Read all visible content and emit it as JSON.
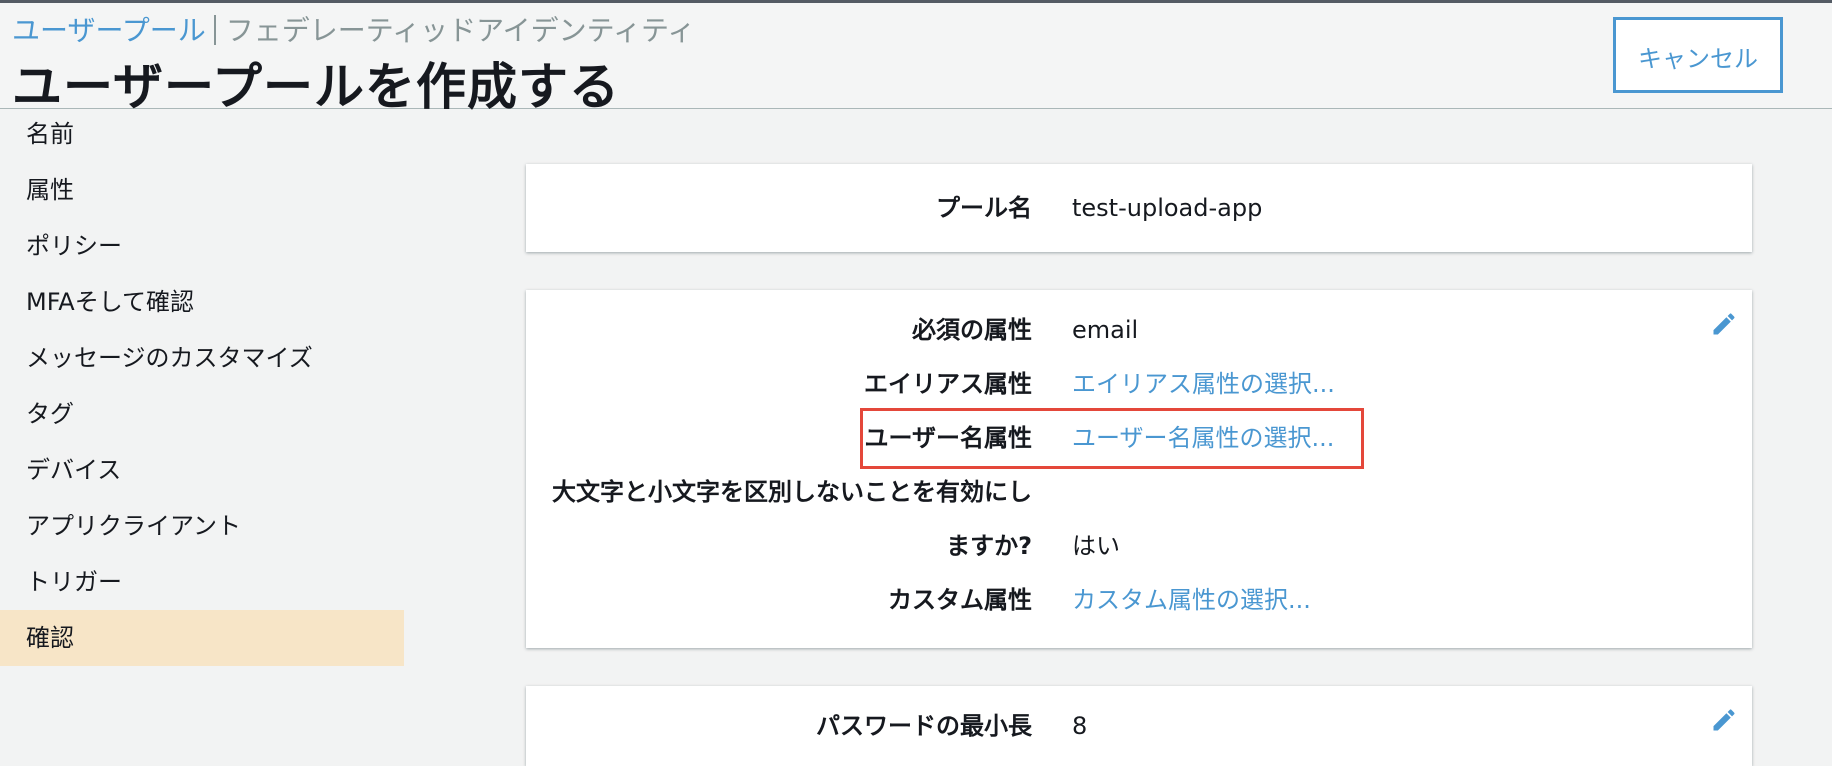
{
  "breadcrumb": {
    "link": "ユーザープール",
    "current": "フェデレーティッドアイデンティティ"
  },
  "page_title": "ユーザープールを作成する",
  "cancel_label": "キャンセル",
  "sidebar": {
    "items": [
      {
        "label": "名前"
      },
      {
        "label": "属性"
      },
      {
        "label": "ポリシー"
      },
      {
        "label": "MFAそして確認"
      },
      {
        "label": "メッセージのカスタマイズ"
      },
      {
        "label": "タグ"
      },
      {
        "label": "デバイス"
      },
      {
        "label": "アプリクライアント"
      },
      {
        "label": "トリガー"
      },
      {
        "label": "確認"
      }
    ],
    "active_index": 9
  },
  "pool_card": {
    "label": "プール名",
    "value": "test-upload-app"
  },
  "attributes_card": {
    "required_label": "必須の属性",
    "required_value": "email",
    "alias_label": "エイリアス属性",
    "alias_link": "エイリアス属性の選択...",
    "username_label": "ユーザー名属性",
    "username_link": "ユーザー名属性の選択...",
    "case_label_line1": "大文字と小文字を区別しないことを有効にし",
    "case_label_line2": "ますか?",
    "case_value": "はい",
    "custom_label": "カスタム属性",
    "custom_link": "カスタム属性の選択..."
  },
  "password_card": {
    "min_length_label": "パスワードの最小長",
    "min_length_value": "8"
  },
  "colors": {
    "link": "#4a97d1",
    "active_nav": "#f7e5c7",
    "highlight": "#e4473a"
  },
  "icons": {
    "edit": "pencil-icon"
  }
}
